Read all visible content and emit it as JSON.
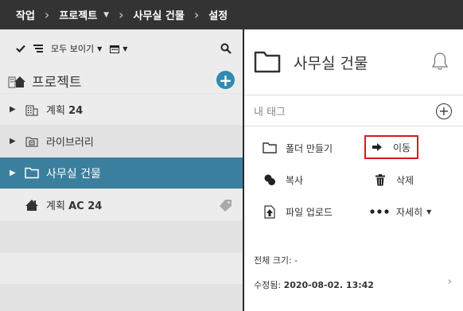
{
  "breadcrumb": {
    "items": [
      "작업",
      "프로젝트",
      "사무실 건물",
      "설정"
    ]
  },
  "toolbar": {
    "show_all_label": "모두 보이기"
  },
  "projects": {
    "title": "프로젝트",
    "items": [
      {
        "label_prefix": "계획 ",
        "label_bold": "24",
        "icon": "building-icon"
      },
      {
        "label": "라이브러리",
        "icon": "library-icon"
      },
      {
        "label": "사무실 건물",
        "icon": "folder-icon",
        "selected": true
      },
      {
        "label_prefix": "계획 ",
        "label_bold": "AC 24",
        "icon": "home-icon"
      }
    ]
  },
  "detail": {
    "title": "사무실 건물",
    "tag_placeholder": "내 태그",
    "actions": {
      "new_folder": "폴더 만들기",
      "move": "이동",
      "copy": "복사",
      "delete": "삭제",
      "upload": "파일 업로드",
      "more": "자세히"
    },
    "total_size_label": "전체 크기: -",
    "modified_label": "수정됨: ",
    "modified_value": "2020-08-02. 13:42"
  },
  "colors": {
    "topbar": "#333333",
    "accent": "#3b7f9e",
    "add_button": "#2e8bb1",
    "highlight_box": "#e3151a"
  }
}
